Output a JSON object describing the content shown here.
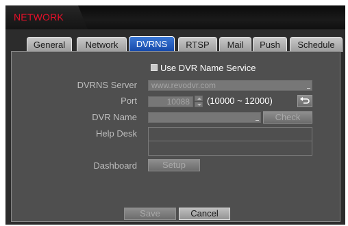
{
  "window": {
    "title": "NETWORK"
  },
  "tabs": [
    {
      "label": "General"
    },
    {
      "label": "Network"
    },
    {
      "label": "DVRNS",
      "active": true
    },
    {
      "label": "RTSP"
    },
    {
      "label": "Mail"
    },
    {
      "label": "Push"
    },
    {
      "label": "Schedule"
    }
  ],
  "dvrns": {
    "use_service_label": "Use DVR Name Service",
    "use_service_checked": false,
    "server_label": "DVRNS Server",
    "server_value": "www.revodvr.com",
    "port_label": "Port",
    "port_value": "10088",
    "port_range": "(10000 ~ 12000)",
    "dvr_name_label": "DVR Name",
    "dvr_name_value": "",
    "check_button": "Check",
    "help_desk_label": "Help Desk",
    "dashboard_label": "Dashboard",
    "setup_button": "Setup"
  },
  "footer": {
    "save_button": "Save",
    "cancel_button": "Cancel"
  },
  "colors": {
    "title_red": "#e8102a",
    "active_tab": "#1447a8",
    "panel_bg": "#4f4f4f"
  }
}
